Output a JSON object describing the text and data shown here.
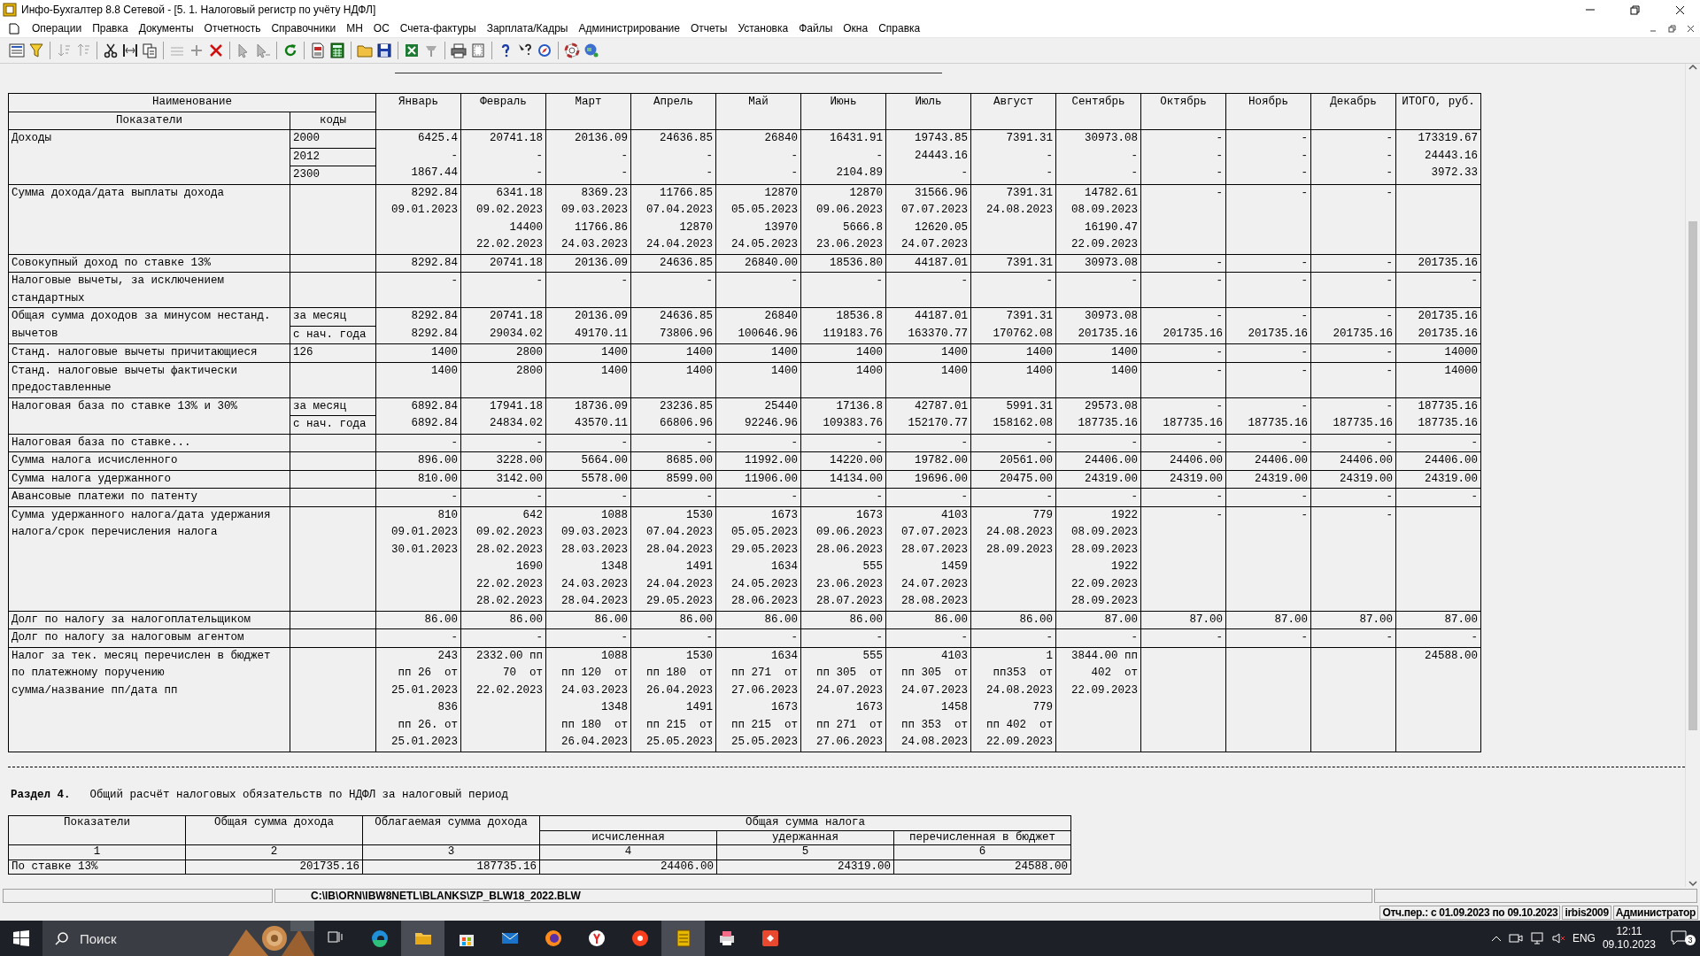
{
  "window": {
    "title": "Инфо-Бухгалтер 8.8 Сетевой - [5. 1. Налоговый регистр по учёту НДФЛ]"
  },
  "menu": [
    "Операции",
    "Правка",
    "Документы",
    "Отчетность",
    "Справочники",
    "МН",
    "ОС",
    "Счета-фактуры",
    "Зарплата/Кадры",
    "Администрирование",
    "Отчеты",
    "Установка",
    "Файлы",
    "Окна",
    "Справка"
  ],
  "report": {
    "header": {
      "name": "Наименование",
      "indicators": "Показатели",
      "codes": "коды",
      "columns": [
        "Январь",
        "Февраль",
        "Март",
        "Апрель",
        "Май",
        "Июнь",
        "Июль",
        "Август",
        "Сентябрь",
        "Октябрь",
        "Ноябрь",
        "Декабрь",
        "ИТОГО, руб."
      ]
    },
    "rows": [
      {
        "label": "Доходы",
        "codes": [
          "2000",
          "2012",
          "2300"
        ],
        "cells": [
          [
            "6425.4",
            "-",
            "1867.44"
          ],
          [
            "20741.18",
            "-",
            "-"
          ],
          [
            "20136.09",
            "-",
            "-"
          ],
          [
            "24636.85",
            "-",
            "-"
          ],
          [
            "26840",
            "-",
            "-"
          ],
          [
            "16431.91",
            "-",
            "2104.89"
          ],
          [
            "19743.85",
            "24443.16",
            "-"
          ],
          [
            "7391.31",
            "-",
            "-"
          ],
          [
            "30973.08",
            "-",
            "-"
          ],
          [
            "-",
            "-",
            "-"
          ],
          [
            "-",
            "-",
            "-"
          ],
          [
            "-",
            "-",
            "-"
          ],
          [
            "173319.67",
            "24443.16",
            "3972.33"
          ]
        ]
      },
      {
        "label": "Сумма дохода/дата выплаты дохода",
        "codes": [],
        "cells": [
          [
            "8292.84",
            "09.01.2023"
          ],
          [
            "6341.18",
            "09.02.2023",
            "14400",
            "22.02.2023"
          ],
          [
            "8369.23",
            "09.03.2023",
            "11766.86",
            "24.03.2023"
          ],
          [
            "11766.85",
            "07.04.2023",
            "12870",
            "24.04.2023"
          ],
          [
            "12870",
            "05.05.2023",
            "13970",
            "24.05.2023"
          ],
          [
            "12870",
            "09.06.2023",
            "5666.8",
            "23.06.2023"
          ],
          [
            "31566.96",
            "07.07.2023",
            "12620.05",
            "24.07.2023"
          ],
          [
            "7391.31",
            "24.08.2023"
          ],
          [
            "14782.61",
            "08.09.2023",
            "16190.47",
            "22.09.2023"
          ],
          [
            "-"
          ],
          [
            "-"
          ],
          [
            "-"
          ],
          null
        ]
      },
      {
        "label": "Совокупный доход по ставке 13%",
        "codes": [],
        "cells": [
          [
            "8292.84"
          ],
          [
            "20741.18"
          ],
          [
            "20136.09"
          ],
          [
            "24636.85"
          ],
          [
            "26840.00"
          ],
          [
            "18536.80"
          ],
          [
            "44187.01"
          ],
          [
            "7391.31"
          ],
          [
            "30973.08"
          ],
          [
            "-"
          ],
          [
            "-"
          ],
          [
            "-"
          ],
          [
            "201735.16"
          ]
        ]
      },
      {
        "label": "Налоговые вычеты, за исключением\nстандартных",
        "codes": [],
        "cells": [
          [
            "-"
          ],
          [
            "-"
          ],
          [
            "-"
          ],
          [
            "-"
          ],
          [
            "-"
          ],
          [
            "-"
          ],
          [
            "-"
          ],
          [
            "-"
          ],
          [
            "-"
          ],
          [
            "-"
          ],
          [
            "-"
          ],
          [
            "-"
          ],
          [
            "-"
          ]
        ]
      },
      {
        "label": "Общая сумма доходов за минусом нестанд.\nвычетов",
        "codes": [
          "за месяц",
          "с нач. года"
        ],
        "cells": [
          [
            "8292.84",
            "8292.84"
          ],
          [
            "20741.18",
            "29034.02"
          ],
          [
            "20136.09",
            "49170.11"
          ],
          [
            "24636.85",
            "73806.96"
          ],
          [
            "26840",
            "100646.96"
          ],
          [
            "18536.8",
            "119183.76"
          ],
          [
            "44187.01",
            "163370.77"
          ],
          [
            "7391.31",
            "170762.08"
          ],
          [
            "30973.08",
            "201735.16"
          ],
          [
            "-",
            "201735.16"
          ],
          [
            "-",
            "201735.16"
          ],
          [
            "-",
            "201735.16"
          ],
          [
            "201735.16",
            "201735.16"
          ]
        ]
      },
      {
        "label": "Станд. налоговые вычеты причитающиеся",
        "codes": [
          "126"
        ],
        "cells": [
          [
            "1400"
          ],
          [
            "2800"
          ],
          [
            "1400"
          ],
          [
            "1400"
          ],
          [
            "1400"
          ],
          [
            "1400"
          ],
          [
            "1400"
          ],
          [
            "1400"
          ],
          [
            "1400"
          ],
          [
            "-"
          ],
          [
            "-"
          ],
          [
            "-"
          ],
          [
            "14000"
          ]
        ]
      },
      {
        "label": "Станд. налоговые вычеты фактически\nпредоставленные",
        "codes": [],
        "cells": [
          [
            "1400"
          ],
          [
            "2800"
          ],
          [
            "1400"
          ],
          [
            "1400"
          ],
          [
            "1400"
          ],
          [
            "1400"
          ],
          [
            "1400"
          ],
          [
            "1400"
          ],
          [
            "1400"
          ],
          [
            "-"
          ],
          [
            "-"
          ],
          [
            "-"
          ],
          [
            "14000"
          ]
        ]
      },
      {
        "label": "Налоговая база по ставке 13% и 30%",
        "codes": [
          "за месяц",
          "с нач. года"
        ],
        "cells": [
          [
            "6892.84",
            "6892.84"
          ],
          [
            "17941.18",
            "24834.02"
          ],
          [
            "18736.09",
            "43570.11"
          ],
          [
            "23236.85",
            "66806.96"
          ],
          [
            "25440",
            "92246.96"
          ],
          [
            "17136.8",
            "109383.76"
          ],
          [
            "42787.01",
            "152170.77"
          ],
          [
            "5991.31",
            "158162.08"
          ],
          [
            "29573.08",
            "187735.16"
          ],
          [
            "-",
            "187735.16"
          ],
          [
            "-",
            "187735.16"
          ],
          [
            "-",
            "187735.16"
          ],
          [
            "187735.16",
            "187735.16"
          ]
        ]
      },
      {
        "label": "Налоговая база по ставке...",
        "codes": [],
        "cells": [
          [
            "-"
          ],
          [
            "-"
          ],
          [
            "-"
          ],
          [
            "-"
          ],
          [
            "-"
          ],
          [
            "-"
          ],
          [
            "-"
          ],
          [
            "-"
          ],
          [
            "-"
          ],
          [
            "-"
          ],
          [
            "-"
          ],
          [
            "-"
          ],
          [
            "-"
          ]
        ]
      },
      {
        "label": "Сумма налога исчисленного",
        "codes": [],
        "cells": [
          [
            "896.00"
          ],
          [
            "3228.00"
          ],
          [
            "5664.00"
          ],
          [
            "8685.00"
          ],
          [
            "11992.00"
          ],
          [
            "14220.00"
          ],
          [
            "19782.00"
          ],
          [
            "20561.00"
          ],
          [
            "24406.00"
          ],
          [
            "24406.00"
          ],
          [
            "24406.00"
          ],
          [
            "24406.00"
          ],
          [
            "24406.00"
          ]
        ]
      },
      {
        "label": "Сумма налога удержанного",
        "codes": [],
        "cells": [
          [
            "810.00"
          ],
          [
            "3142.00"
          ],
          [
            "5578.00"
          ],
          [
            "8599.00"
          ],
          [
            "11906.00"
          ],
          [
            "14134.00"
          ],
          [
            "19696.00"
          ],
          [
            "20475.00"
          ],
          [
            "24319.00"
          ],
          [
            "24319.00"
          ],
          [
            "24319.00"
          ],
          [
            "24319.00"
          ],
          [
            "24319.00"
          ]
        ]
      },
      {
        "label": "Авансовые платежи по патенту",
        "codes": [],
        "cells": [
          [
            "-"
          ],
          [
            "-"
          ],
          [
            "-"
          ],
          [
            "-"
          ],
          [
            "-"
          ],
          [
            "-"
          ],
          [
            "-"
          ],
          [
            "-"
          ],
          [
            "-"
          ],
          [
            "-"
          ],
          [
            "-"
          ],
          [
            "-"
          ],
          [
            "-"
          ]
        ]
      },
      {
        "label": "Сумма удержанного налога/дата удержания\nналога/срок перечисления налога",
        "codes": [],
        "cells": [
          [
            "810",
            "09.01.2023",
            "30.01.2023"
          ],
          [
            "642",
            "09.02.2023",
            "28.02.2023",
            "1690",
            "22.02.2023",
            "28.02.2023"
          ],
          [
            "1088",
            "09.03.2023",
            "28.03.2023",
            "1348",
            "24.03.2023",
            "28.04.2023"
          ],
          [
            "1530",
            "07.04.2023",
            "28.04.2023",
            "1491",
            "24.04.2023",
            "29.05.2023"
          ],
          [
            "1673",
            "05.05.2023",
            "29.05.2023",
            "1634",
            "24.05.2023",
            "28.06.2023"
          ],
          [
            "1673",
            "09.06.2023",
            "28.06.2023",
            "555",
            "23.06.2023",
            "28.07.2023"
          ],
          [
            "4103",
            "07.07.2023",
            "28.07.2023",
            "1459",
            "24.07.2023",
            "28.08.2023"
          ],
          [
            "779",
            "24.08.2023",
            "28.09.2023"
          ],
          [
            "1922",
            "08.09.2023",
            "28.09.2023",
            "1922",
            "22.09.2023",
            "28.09.2023"
          ],
          [
            "-"
          ],
          [
            "-"
          ],
          [
            "-"
          ],
          null
        ]
      },
      {
        "label": "Долг по налогу за налогоплательщиком",
        "codes": [],
        "cells": [
          [
            "86.00"
          ],
          [
            "86.00"
          ],
          [
            "86.00"
          ],
          [
            "86.00"
          ],
          [
            "86.00"
          ],
          [
            "86.00"
          ],
          [
            "86.00"
          ],
          [
            "86.00"
          ],
          [
            "87.00"
          ],
          [
            "87.00"
          ],
          [
            "87.00"
          ],
          [
            "87.00"
          ],
          [
            "87.00"
          ]
        ]
      },
      {
        "label": "Долг по налогу за налоговым агентом",
        "codes": [],
        "cells": [
          [
            "-"
          ],
          [
            "-"
          ],
          [
            "-"
          ],
          [
            "-"
          ],
          [
            "-"
          ],
          [
            "-"
          ],
          [
            "-"
          ],
          [
            "-"
          ],
          [
            "-"
          ],
          [
            "-"
          ],
          [
            "-"
          ],
          [
            "-"
          ],
          [
            "-"
          ]
        ]
      },
      {
        "label": "Налог за тек. месяц перечислен в бюджет\nпо платежному поручению\nсумма/название пп/дата пп",
        "codes": [],
        "cells": [
          [
            "243",
            "пп 26  от",
            "25.01.2023",
            "836",
            "пп 26. от",
            "25.01.2023"
          ],
          [
            "2332.00 пп",
            "70  от",
            "22.02.2023"
          ],
          [
            "1088",
            "пп 120  от",
            "24.03.2023",
            "1348",
            "пп 180  от",
            "26.04.2023"
          ],
          [
            "1530",
            "пп 180  от",
            "26.04.2023",
            "1491",
            "пп 215  от",
            "25.05.2023"
          ],
          [
            "1634",
            "пп 271  от",
            "27.06.2023",
            "1673",
            "пп 215  от",
            "25.05.2023"
          ],
          [
            "555",
            "пп 305  от",
            "24.07.2023",
            "1673",
            "пп 271  от",
            "27.06.2023"
          ],
          [
            "4103",
            "пп 305  от",
            "24.07.2023",
            "1458",
            "пп 353  от",
            "24.08.2023"
          ],
          [
            "1",
            "пп353  от",
            "24.08.2023",
            "779",
            "пп 402  от",
            "22.09.2023"
          ],
          [
            "3844.00 пп",
            "402  от",
            "22.09.2023"
          ],
          null,
          null,
          null,
          [
            "24588.00"
          ]
        ]
      }
    ]
  },
  "section4": {
    "number": "Раздел 4.",
    "title": "Общий расчёт налоговых обязательств по НДФЛ за налоговый период",
    "columns": [
      "Показатели",
      "Общая сумма дохода",
      "Облагаемая сумма дохода"
    ],
    "group": "Общая сумма налога",
    "group_columns": [
      "исчисленная",
      "удержанная",
      "перечисленная в бюджет"
    ],
    "numbers": [
      "1",
      "2",
      "3",
      "4",
      "5",
      "6"
    ],
    "rows": [
      [
        "По ставке 13%",
        "201735.16",
        "187735.16",
        "24406.00",
        "24319.00",
        "24588.00"
      ]
    ]
  },
  "path_bar": "C:\\IB\\ORN\\IBW8NETL\\BLANKS\\ZP_BLW18_2022.BLW",
  "status_bar": [
    "Отч.пер.: с 01.09.2023 по 09.10.2023",
    "irbis2009",
    "Администратор"
  ],
  "taskbar": {
    "search_placeholder": "Поиск",
    "language": "ENG",
    "time": "12:11",
    "date": "09.10.2023",
    "notifications": "3"
  }
}
